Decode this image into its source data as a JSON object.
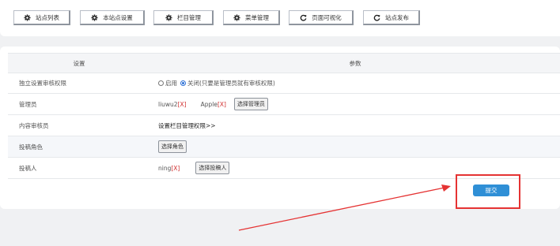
{
  "toolbar": {
    "buttons": [
      {
        "label": "站点列表",
        "icon": "gear-icon"
      },
      {
        "label": "本站点设置",
        "icon": "gear-icon"
      },
      {
        "label": "栏目管理",
        "icon": "gear-icon"
      },
      {
        "label": "菜单管理",
        "icon": "gear-icon"
      },
      {
        "label": "页面可视化",
        "icon": "refresh-icon"
      },
      {
        "label": "站点发布",
        "icon": "refresh-icon"
      }
    ]
  },
  "table": {
    "headers": {
      "setting": "设置",
      "params": "参数"
    },
    "rows": {
      "audit": {
        "label": "独立设置审核权限",
        "option_enable": "启用",
        "option_close": "关闭(只要是管理员就有审核权限)",
        "selected": "关闭"
      },
      "admins": {
        "label": "管理员",
        "users": [
          {
            "name": "liuwu2",
            "remove": "[X]"
          },
          {
            "name": "Apple",
            "remove": "[X]"
          }
        ],
        "button": "选择管理员"
      },
      "reviewers": {
        "label": "内容审核员",
        "link": "设置栏目管理权限>>"
      },
      "roles": {
        "label": "投稿角色",
        "button": "选择角色"
      },
      "contributors": {
        "label": "投稿人",
        "users": [
          {
            "name": "ning",
            "remove": "[X]"
          }
        ],
        "button": "选择投稿人"
      }
    }
  },
  "submit_label": "提交",
  "colors": {
    "accent": "#2f8fd6",
    "highlight": "#e53333",
    "remove": "#d03030"
  }
}
